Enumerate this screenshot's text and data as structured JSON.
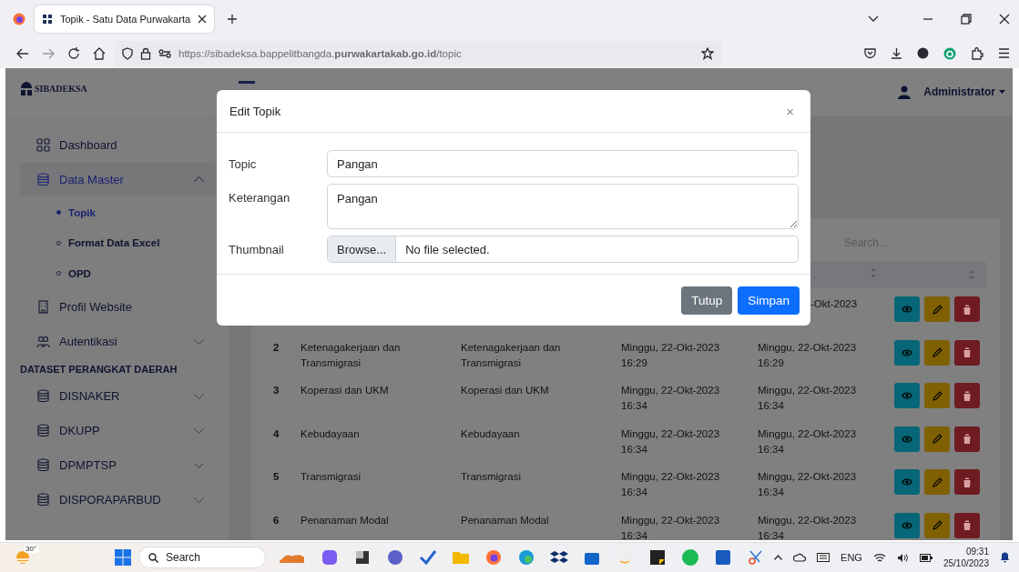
{
  "browser": {
    "tab_title": "Topik - Satu Data Purwakarta",
    "url": "https://sibadeksa.bappelitbangda.**purwakartakab.go.id**/topic"
  },
  "header": {
    "logo": "SIBADEKSA",
    "user": "Administrator"
  },
  "sidebar": {
    "items": [
      {
        "kind": "item",
        "label": "Dashboard",
        "selected": false
      },
      {
        "kind": "item",
        "label": "Data Master",
        "selected": true,
        "expanded": true,
        "children": [
          {
            "label": "Topik",
            "selected": true
          },
          {
            "label": "Format Data Excel",
            "selected": false
          },
          {
            "label": "OPD",
            "selected": false
          }
        ]
      },
      {
        "kind": "item",
        "label": "Profil Website",
        "selected": false
      },
      {
        "kind": "item",
        "label": "Autentikasi",
        "selected": false,
        "expanded": false
      },
      {
        "kind": "heading",
        "label": "DATASET PERANGKAT DAERAH"
      },
      {
        "kind": "item",
        "label": "DISNAKER",
        "selected": false,
        "expanded": false
      },
      {
        "kind": "item",
        "label": "DKUPP",
        "selected": false,
        "expanded": false
      },
      {
        "kind": "item",
        "label": "DPMPTSP",
        "selected": false,
        "expanded": false
      },
      {
        "kind": "item",
        "label": "DISPORAPARBUD",
        "selected": false,
        "expanded": false
      }
    ]
  },
  "table": {
    "search": {
      "placeholder": "Search..."
    },
    "rows": [
      {
        "updated": "-Okt-2023",
        "cut": true
      },
      {
        "no": "2",
        "topic": "Ketenagakerjaan dan Transmigrasi",
        "description": "Ketenagakerjaan dan Transmigrasi",
        "created": "Minggu, 22-Okt-2023 16:29",
        "updated": "Minggu, 22-Okt-2023 16:29"
      },
      {
        "no": "3",
        "topic": "Koperasi dan UKM",
        "description": "Koperasi dan UKM",
        "created": "Minggu, 22-Okt-2023 16:34",
        "updated": "Minggu, 22-Okt-2023 16:34"
      },
      {
        "no": "4",
        "topic": "Kebudayaan",
        "description": "Kebudayaan",
        "created": "Minggu, 22-Okt-2023 16:34",
        "updated": "Minggu, 22-Okt-2023 16:34"
      },
      {
        "no": "5",
        "topic": "Transmigrasi",
        "description": "Transmigrasi",
        "created": "Minggu, 22-Okt-2023 16:34",
        "updated": "Minggu, 22-Okt-2023 16:34"
      },
      {
        "no": "6",
        "topic": "Penanaman Modal",
        "description": "Penanaman Modal",
        "created": "Minggu, 22-Okt-2023 16:34",
        "updated": "Minggu, 22-Okt-2023 16:34"
      }
    ]
  },
  "modal": {
    "title": "Edit Topik",
    "close": "×",
    "fields": [
      {
        "kind": "text",
        "label": "Topic",
        "value": "Pangan"
      },
      {
        "kind": "textarea",
        "label": "Keterangan",
        "value": "Pangan"
      },
      {
        "kind": "file",
        "label": "Thumbnail",
        "button": "Browse...",
        "value": "No file selected."
      }
    ],
    "buttons": [
      {
        "kind": "secondary",
        "label": "Tutup"
      },
      {
        "kind": "primary",
        "label": "Simpan"
      }
    ]
  },
  "taskbar": {
    "weather": "30°",
    "search": "Search",
    "language": "ENG",
    "time": "09:31",
    "date": "25/10/2023"
  }
}
